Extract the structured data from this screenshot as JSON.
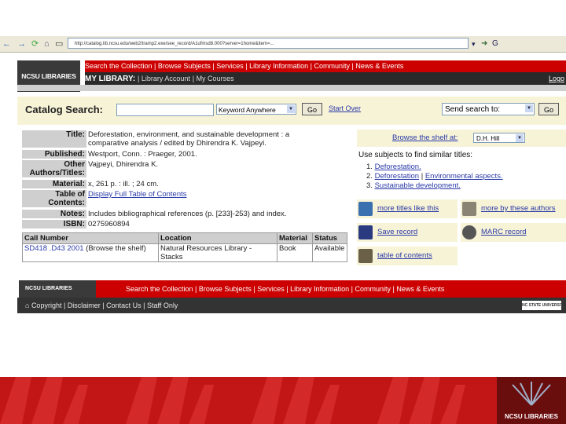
{
  "browser": {
    "back_label": "←",
    "forward_label": "→",
    "address_text": "http://catalog.lib.ncsu.edu/web2/tramp2.exe/see_record/A1ufmsd8.000?server=1home&item=..."
  },
  "header": {
    "logo_text": "NCSU LIBRARIES",
    "topnav_text": "Search the Collection | Browse Subjects | Services | Library Information | Community | News & Events",
    "mylibrary_label": "MY LIBRARY:",
    "library_account": "Library Account",
    "my_courses": "My Courses",
    "logout": "Logo"
  },
  "search": {
    "label": "Catalog Search:",
    "input_value": "",
    "keyword_option": "Keyword Anywhere",
    "go_label": "Go",
    "start_over": "Start Over",
    "send_to": "Send search to:",
    "go2_label": "Go"
  },
  "record": {
    "title_label": "Title:",
    "title_value_1": "Deforestation, environment, and sustainable development : a",
    "title_value_2": "comparative analysis / edited by Dhirendra K. Vajpeyi.",
    "published_label": "Published:",
    "published_value": "Westport, Conn. : Praeger, 2001.",
    "other_label_1": "Other",
    "other_label_2": "Authors/Titles:",
    "other_value": "Vajpeyi, Dhirendra K.",
    "material_label": "Material:",
    "material_value": "x, 261 p. : ill. ; 24 cm.",
    "toc_label_1": "Table of",
    "toc_label_2": "Contents:",
    "toc_value": "Display Full Table of Contents",
    "notes_label": "Notes:",
    "notes_value": "Includes bibliographical references (p. [233]-253) and index.",
    "isbn_label": "ISBN:",
    "isbn_value": "0275960894"
  },
  "shelf": {
    "link": "Browse the shelf at:",
    "select": "D.H. Hill"
  },
  "subjects": {
    "heading": "Use subjects to find similar titles:",
    "items": [
      {
        "num": "1.",
        "text": "Deforestation."
      },
      {
        "num": "2.",
        "text": "Deforestation",
        "extra": "Environmental aspects."
      },
      {
        "num": "3.",
        "text": "Sustainable development."
      }
    ]
  },
  "actions": {
    "more_titles": "more titles like this",
    "more_by_authors": "more by these authors",
    "save_record": "Save record",
    "marc_record": "MARC record",
    "table_of_contents": "table of contents"
  },
  "holdings": {
    "headers": [
      "Call Number",
      "Location",
      "Material",
      "Status"
    ],
    "rows": [
      {
        "call": "SD418 .D43 2001",
        "browse": "(Browse the shelf)",
        "location_1": "Natural Resources Library -",
        "location_2": "Stacks",
        "material": "Book",
        "status": "Available"
      }
    ]
  },
  "footer": {
    "logo_text": "NCSU LIBRARIES",
    "nav_text": "Search the Collection | Browse Subjects | Services | Library Information | Community | News & Events",
    "links": "Copyright | Disclaimer | Contact Us | Staff Only",
    "ncstate": "NC STATE UNIVERSITY"
  },
  "slide": {
    "logo_text": "NCSU LIBRARIES"
  }
}
